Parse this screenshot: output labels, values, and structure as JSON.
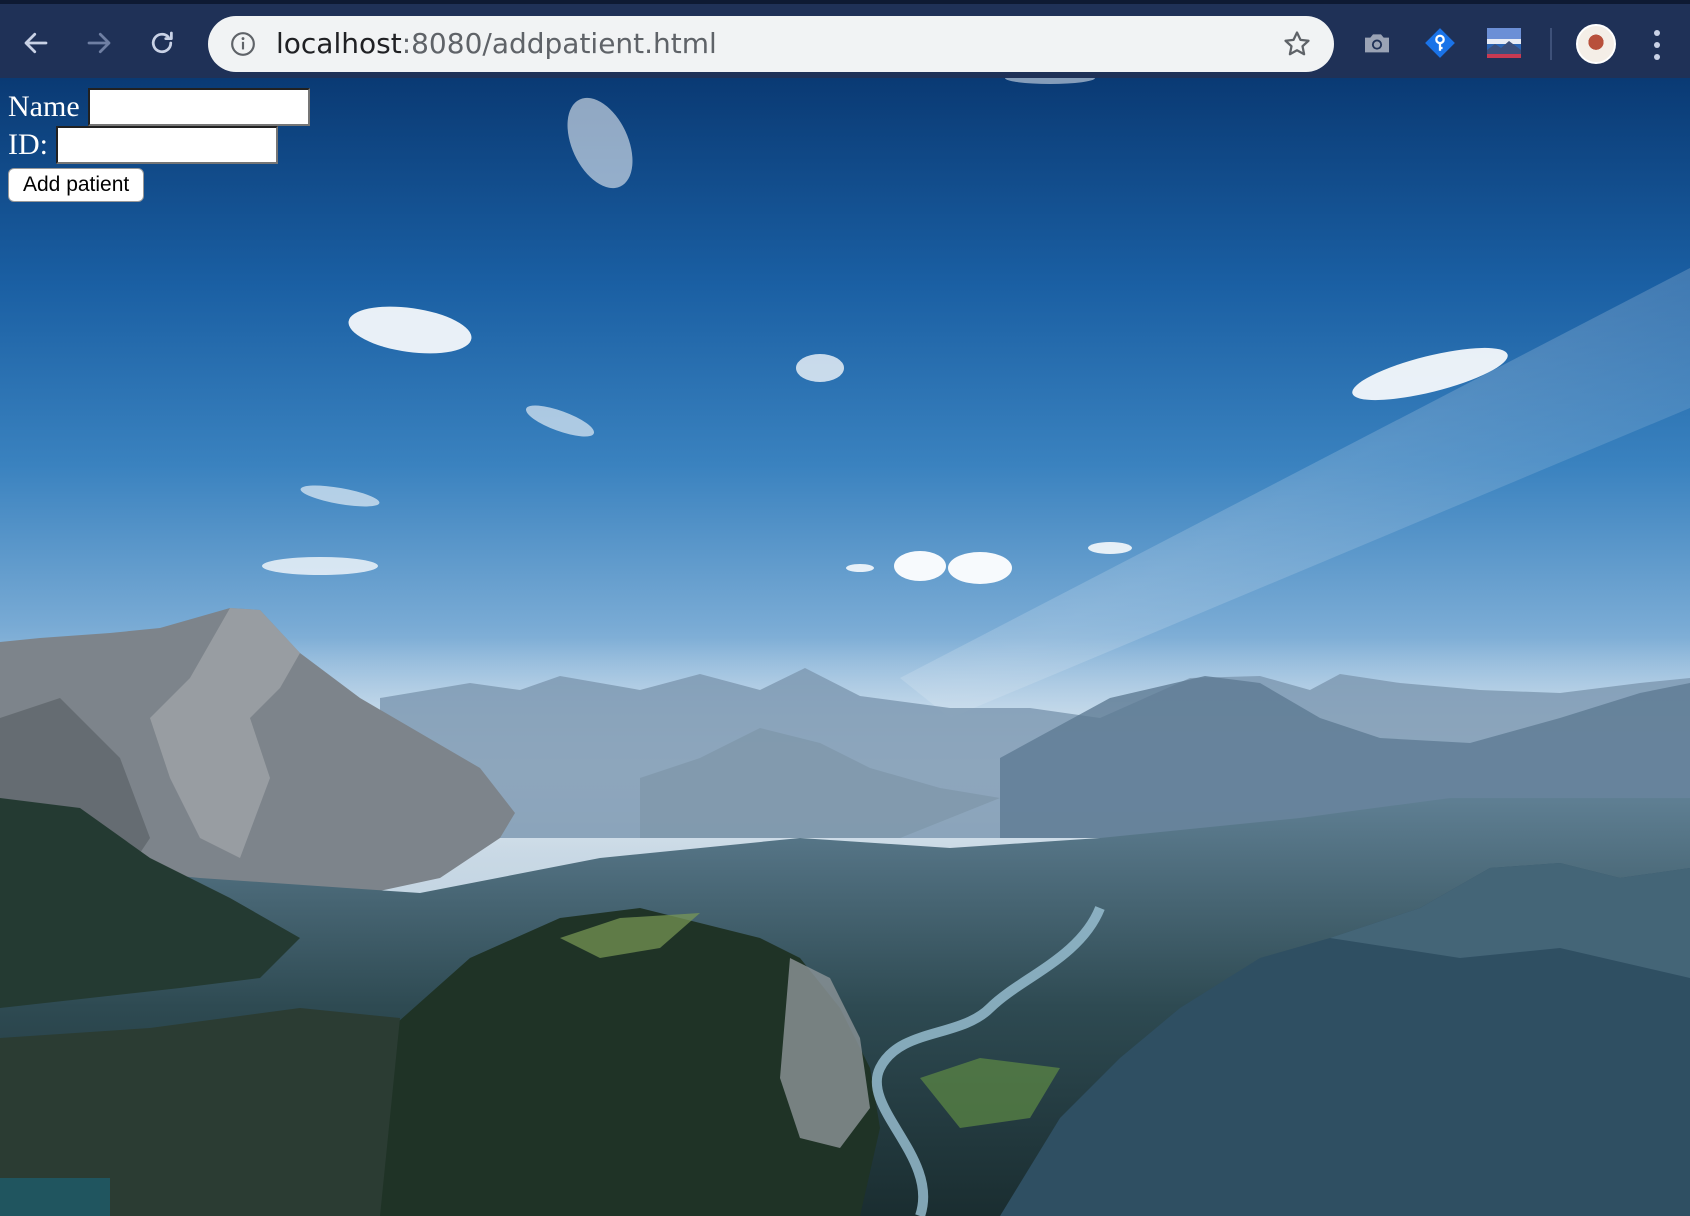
{
  "browser": {
    "url_host": "localhost",
    "url_rest": ":8080/addpatient.html",
    "icons": {
      "back": "arrow-left-icon",
      "forward": "arrow-right-icon",
      "reload": "reload-icon",
      "site_info": "info-circle-icon",
      "bookmark": "star-icon",
      "ext1": "camera-icon",
      "ext2": "key-diamond-icon",
      "ext3": "landscape-thumbnail-icon",
      "profile": "avatar",
      "menu": "kebab-menu-icon"
    }
  },
  "form": {
    "name_label": "Name",
    "name_value": "",
    "id_label": "ID:",
    "id_value": "",
    "submit_label": "Add patient"
  },
  "colors": {
    "chrome": "#1f3157",
    "omnibox": "#f1f3f4",
    "label_text": "#ffffff"
  }
}
